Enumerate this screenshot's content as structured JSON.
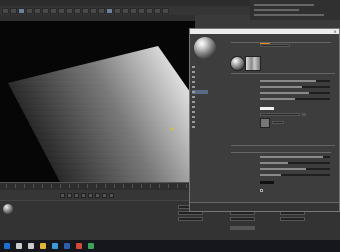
{
  "menubar": {
    "items": [
      "",
      "",
      "",
      "",
      "",
      "",
      "",
      "",
      "",
      "",
      "",
      ""
    ]
  },
  "toolbar": {
    "icons": [
      "undo-icon",
      "redo-icon",
      "select-icon",
      "move-icon",
      "scale-icon",
      "rotate-icon",
      "x-axis-icon",
      "y-axis-icon",
      "z-axis-icon",
      "coordinate-icon",
      "render-view-icon",
      "render-icon",
      "render-settings-icon",
      "cube-icon",
      "spline-icon",
      "nurbs-icon",
      "array-icon",
      "deformer-icon",
      "scene-icon",
      "camera-icon",
      "light-icon"
    ]
  },
  "subbar": {
    "items": [
      "",
      "",
      "",
      "",
      "",
      "",
      ""
    ]
  },
  "viewport": {
    "plane_gradient_from": "#101010",
    "plane_gradient_to": "#f2f2f2",
    "background": "#060606"
  },
  "material_editor": {
    "title": "",
    "material_name": "",
    "channels": [
      "",
      "",
      "",
      "",
      "",
      "",
      "",
      "",
      "",
      "",
      "",
      "",
      "",
      "",
      ""
    ],
    "selected_channel": 5,
    "accent_color": "#e08a18",
    "sliders": [
      0.8,
      0.6,
      0.7,
      0.5,
      0.9,
      0.4,
      0.65,
      0.3
    ]
  },
  "timeline": {
    "frame_start": "",
    "frame_end": ""
  },
  "taskbar": {
    "icons": [
      "windows-icon",
      "search-icon",
      "task-view-icon",
      "explorer-icon",
      "browser-icon",
      "cinema4d-icon",
      "media-icon",
      "chat-icon"
    ],
    "icon_colors": [
      "#1f6fd1",
      "#cccccc",
      "#cccccc",
      "#e7b43c",
      "#3a9ad9",
      "#2d5fa8",
      "#d04a3a",
      "#3aa65a"
    ],
    "clock": ""
  }
}
